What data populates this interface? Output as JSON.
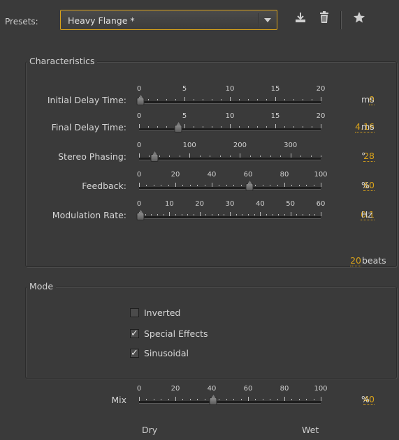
{
  "presets": {
    "label": "Presets:",
    "value": "Heavy Flange *",
    "icons": [
      "save-preset-icon",
      "delete-preset-icon",
      "favorite-star-icon"
    ]
  },
  "characteristics": {
    "title": "Characteristics",
    "sliders": [
      {
        "label": "Initial Delay Time:",
        "ticks": [
          "0",
          "5",
          "10",
          "15",
          "20"
        ],
        "min": 0,
        "max": 20,
        "value": "0",
        "unit": "ms",
        "numeric": 0
      },
      {
        "label": "Final Delay Time:",
        "ticks": [
          "0",
          "5",
          "10",
          "15",
          "20"
        ],
        "min": 0,
        "max": 20,
        "value": "4.16",
        "unit": "ms",
        "numeric": 4.16
      },
      {
        "label": "Stereo Phasing:",
        "ticks": [
          "0",
          "100",
          "200",
          "300"
        ],
        "min": 0,
        "max": 360,
        "value": "28",
        "unit": "°",
        "numeric": 28
      },
      {
        "label": "Feedback:",
        "ticks": [
          "0",
          "20",
          "40",
          "60",
          "80",
          "100"
        ],
        "min": 0,
        "max": 100,
        "value": "60",
        "unit": "%",
        "numeric": 60
      },
      {
        "label": "Modulation Rate:",
        "ticks": [
          "0",
          "10",
          "20",
          "30",
          "40",
          "50",
          "60"
        ],
        "min": 0,
        "max": 60,
        "value": "0.1",
        "unit": "Hz",
        "numeric": 0.1
      }
    ],
    "beats": {
      "value": "20",
      "unit": "beats"
    }
  },
  "mode": {
    "title": "Mode",
    "options": [
      {
        "label": "Inverted",
        "checked": false
      },
      {
        "label": "Special Effects",
        "checked": true
      },
      {
        "label": "Sinusoidal",
        "checked": true
      }
    ]
  },
  "mix": {
    "label": "Mix",
    "ticks": [
      "0",
      "20",
      "40",
      "60",
      "80",
      "100"
    ],
    "min": 0,
    "max": 100,
    "value": "40",
    "unit": "%",
    "numeric": 40,
    "dry_label": "Dry",
    "wet_label": "Wet"
  },
  "colors": {
    "accent": "#d9a21a",
    "background": "#3a3a3a"
  }
}
